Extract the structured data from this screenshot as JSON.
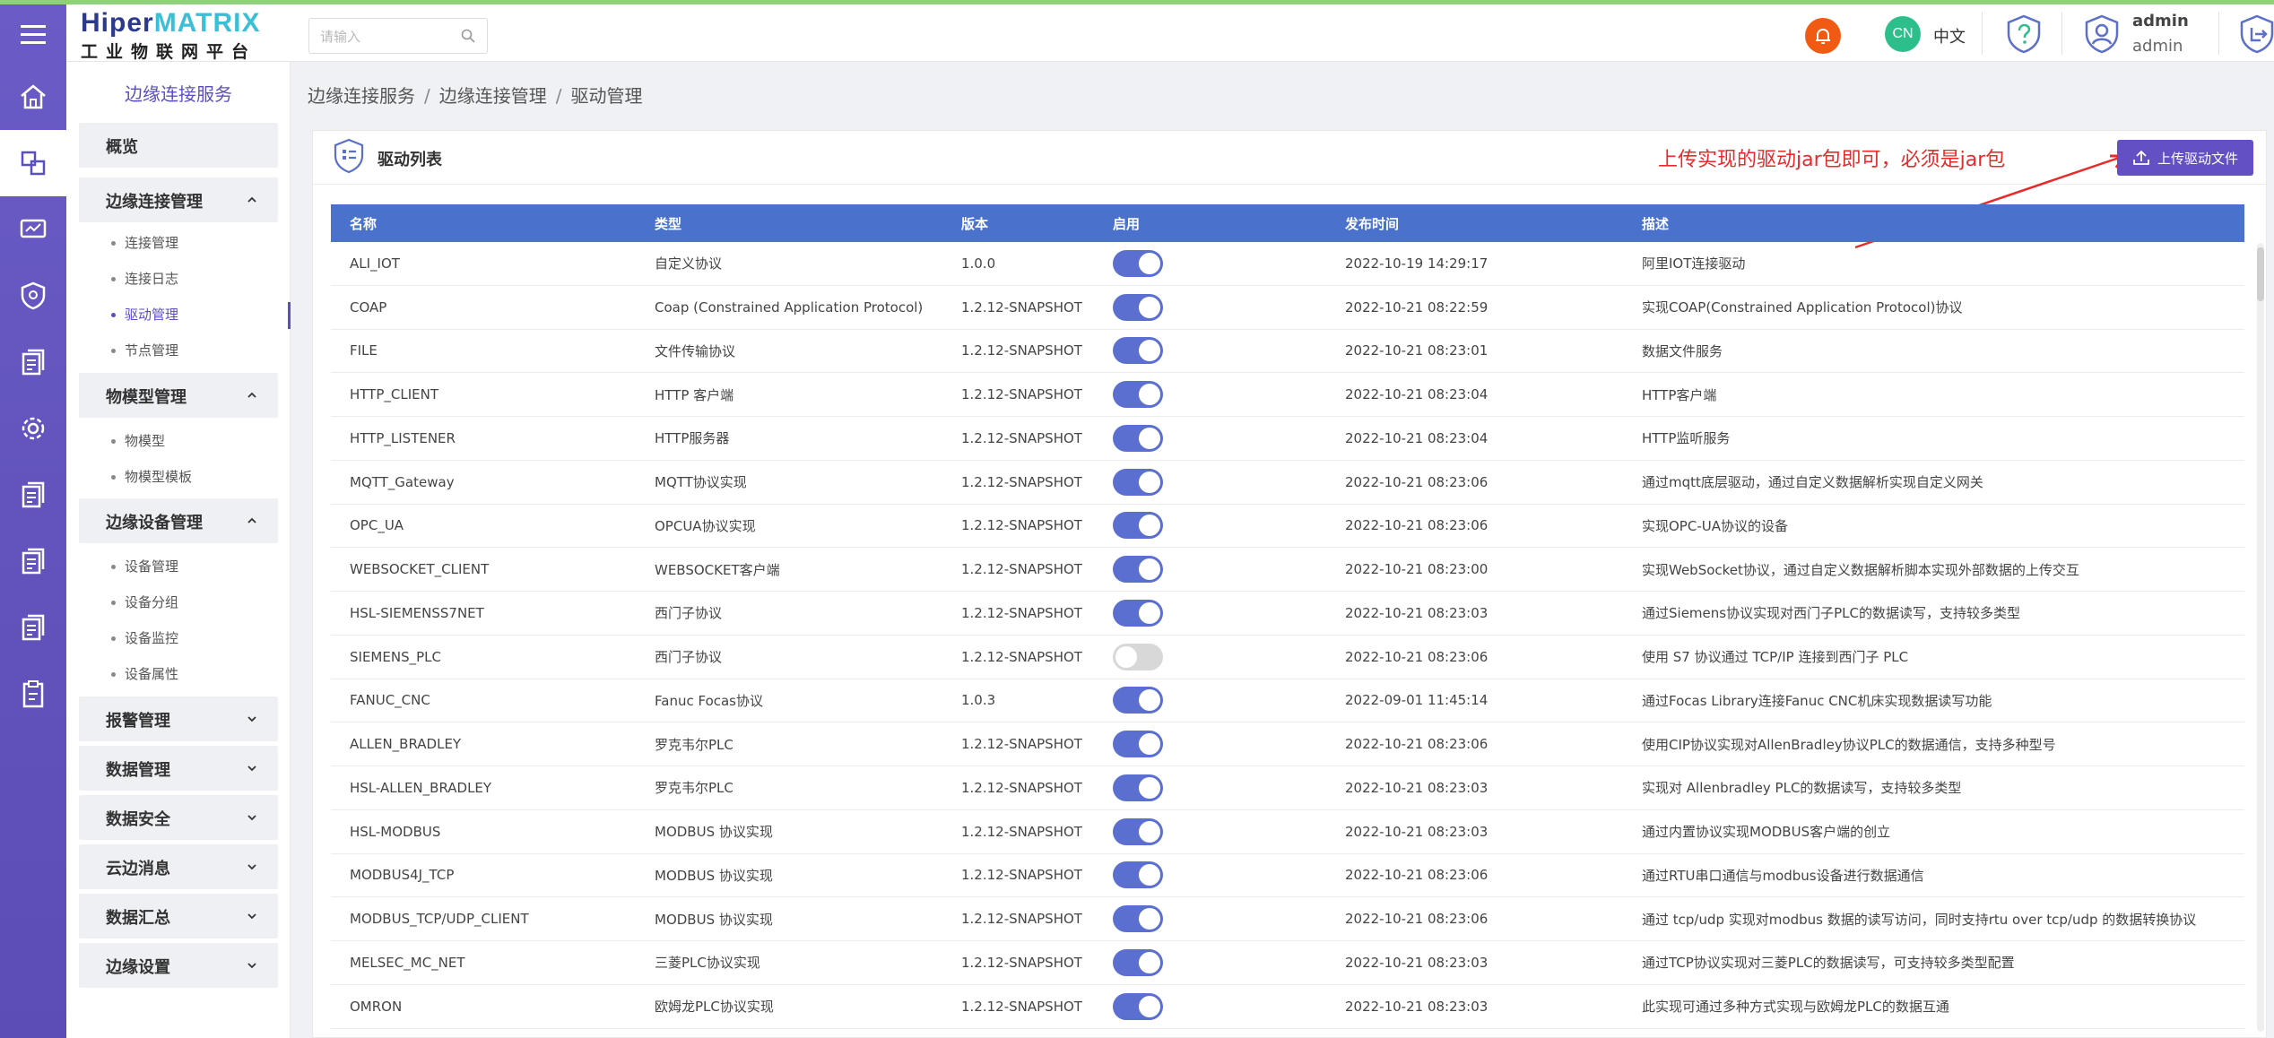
{
  "header": {
    "logo_part1": "Hiper",
    "logo_part2": "MATRIX",
    "logo_sub": "工业物联网平台",
    "search_placeholder": "请输入",
    "lang_badge": "CN",
    "lang_label": "中文",
    "user_name": "admin",
    "user_role": "admin"
  },
  "subnav": {
    "title": "边缘连接服务",
    "overview": "概览",
    "group_edge_conn": "边缘连接管理",
    "edge_items": [
      "连接管理",
      "连接日志",
      "驱动管理",
      "节点管理"
    ],
    "group_model": "物模型管理",
    "model_items": [
      "物模型",
      "物模型模板"
    ],
    "group_device": "边缘设备管理",
    "device_items": [
      "设备管理",
      "设备分组",
      "设备监控",
      "设备属性"
    ],
    "collapsed": [
      "报警管理",
      "数据管理",
      "数据安全",
      "云边消息",
      "数据汇总",
      "边缘设置"
    ]
  },
  "breadcrumb": [
    "边缘连接服务",
    "边缘连接管理",
    "驱动管理"
  ],
  "card": {
    "title": "驱动列表",
    "annotation": "上传实现的驱动jar包即可，必须是jar包",
    "upload_label": "上传驱动文件"
  },
  "table": {
    "headers": [
      "名称",
      "类型",
      "版本",
      "启用",
      "发布时间",
      "描述"
    ],
    "rows": [
      {
        "name": "ALI_IOT",
        "type": "自定义协议",
        "version": "1.0.0",
        "enabled": true,
        "time": "2022-10-19 14:29:17",
        "desc": "阿里IOT连接驱动"
      },
      {
        "name": "COAP",
        "type": "Coap (Constrained Application Protocol)协...",
        "version": "1.2.12-SNAPSHOT",
        "enabled": true,
        "time": "2022-10-21 08:22:59",
        "desc": "实现COAP(Constrained Application Protocol)协议"
      },
      {
        "name": "FILE",
        "type": "文件传输协议",
        "version": "1.2.12-SNAPSHOT",
        "enabled": true,
        "time": "2022-10-21 08:23:01",
        "desc": "数据文件服务"
      },
      {
        "name": "HTTP_CLIENT",
        "type": "HTTP 客户端",
        "version": "1.2.12-SNAPSHOT",
        "enabled": true,
        "time": "2022-10-21 08:23:04",
        "desc": "HTTP客户端"
      },
      {
        "name": "HTTP_LISTENER",
        "type": "HTTP服务器",
        "version": "1.2.12-SNAPSHOT",
        "enabled": true,
        "time": "2022-10-21 08:23:04",
        "desc": "HTTP监听服务"
      },
      {
        "name": "MQTT_Gateway",
        "type": "MQTT协议实现",
        "version": "1.2.12-SNAPSHOT",
        "enabled": true,
        "time": "2022-10-21 08:23:06",
        "desc": "通过mqtt底层驱动，通过自定义数据解析实现自定义网关"
      },
      {
        "name": "OPC_UA",
        "type": "OPCUA协议实现",
        "version": "1.2.12-SNAPSHOT",
        "enabled": true,
        "time": "2022-10-21 08:23:06",
        "desc": "实现OPC-UA协议的设备"
      },
      {
        "name": "WEBSOCKET_CLIENT",
        "type": "WEBSOCKET客户端",
        "version": "1.2.12-SNAPSHOT",
        "enabled": true,
        "time": "2022-10-21 08:23:00",
        "desc": "实现WebSocket协议，通过自定义数据解析脚本实现外部数据的上传交互"
      },
      {
        "name": "HSL-SIEMENSS7NET",
        "type": "西门子协议",
        "version": "1.2.12-SNAPSHOT",
        "enabled": true,
        "time": "2022-10-21 08:23:03",
        "desc": "通过Siemens协议实现对西门子PLC的数据读写，支持较多类型"
      },
      {
        "name": "SIEMENS_PLC",
        "type": "西门子协议",
        "version": "1.2.12-SNAPSHOT",
        "enabled": false,
        "time": "2022-10-21 08:23:06",
        "desc": "使用 S7 协议通过 TCP/IP 连接到西门子 PLC"
      },
      {
        "name": "FANUC_CNC",
        "type": "Fanuc Focas协议",
        "version": "1.0.3",
        "enabled": true,
        "time": "2022-09-01 11:45:14",
        "desc": "通过Focas Library连接Fanuc CNC机床实现数据读写功能"
      },
      {
        "name": "ALLEN_BRADLEY",
        "type": "罗克韦尔PLC",
        "version": "1.2.12-SNAPSHOT",
        "enabled": true,
        "time": "2022-10-21 08:23:06",
        "desc": "使用CIP协议实现对AllenBradley协议PLC的数据通信，支持多种型号"
      },
      {
        "name": "HSL-ALLEN_BRADLEY",
        "type": "罗克韦尔PLC",
        "version": "1.2.12-SNAPSHOT",
        "enabled": true,
        "time": "2022-10-21 08:23:03",
        "desc": "实现对 Allenbradley PLC的数据读写，支持较多类型"
      },
      {
        "name": "HSL-MODBUS",
        "type": "MODBUS 协议实现",
        "version": "1.2.12-SNAPSHOT",
        "enabled": true,
        "time": "2022-10-21 08:23:03",
        "desc": "通过内置协议实现MODBUS客户端的创立"
      },
      {
        "name": "MODBUS4J_TCP",
        "type": "MODBUS 协议实现",
        "version": "1.2.12-SNAPSHOT",
        "enabled": true,
        "time": "2022-10-21 08:23:06",
        "desc": "通过RTU串口通信与modbus设备进行数据通信"
      },
      {
        "name": "MODBUS_TCP/UDP_CLIENT",
        "type": "MODBUS 协议实现",
        "version": "1.2.12-SNAPSHOT",
        "enabled": true,
        "time": "2022-10-21 08:23:06",
        "desc": "通过 tcp/udp 实现对modbus 数据的读写访问，同时支持rtu over tcp/udp 的数据转换协议"
      },
      {
        "name": "MELSEC_MC_NET",
        "type": "三菱PLC协议实现",
        "version": "1.2.12-SNAPSHOT",
        "enabled": true,
        "time": "2022-10-21 08:23:03",
        "desc": "通过TCP协议实现对三菱PLC的数据读写，可支持较多类型配置"
      },
      {
        "name": "OMRON",
        "type": "欧姆龙PLC协议实现",
        "version": "1.2.12-SNAPSHOT",
        "enabled": true,
        "time": "2022-10-21 08:23:03",
        "desc": "此实现可通过多种方式实现与欧姆龙PLC的数据互通"
      }
    ]
  },
  "colors": {
    "rail": "#6a5bc6",
    "accent": "#5a4fc1",
    "table_header": "#4a72cc",
    "toggle_on": "#5b6fd1",
    "annotation": "#e82a2a",
    "bell": "#f05a12",
    "lang_badge": "#2cbf8c"
  }
}
